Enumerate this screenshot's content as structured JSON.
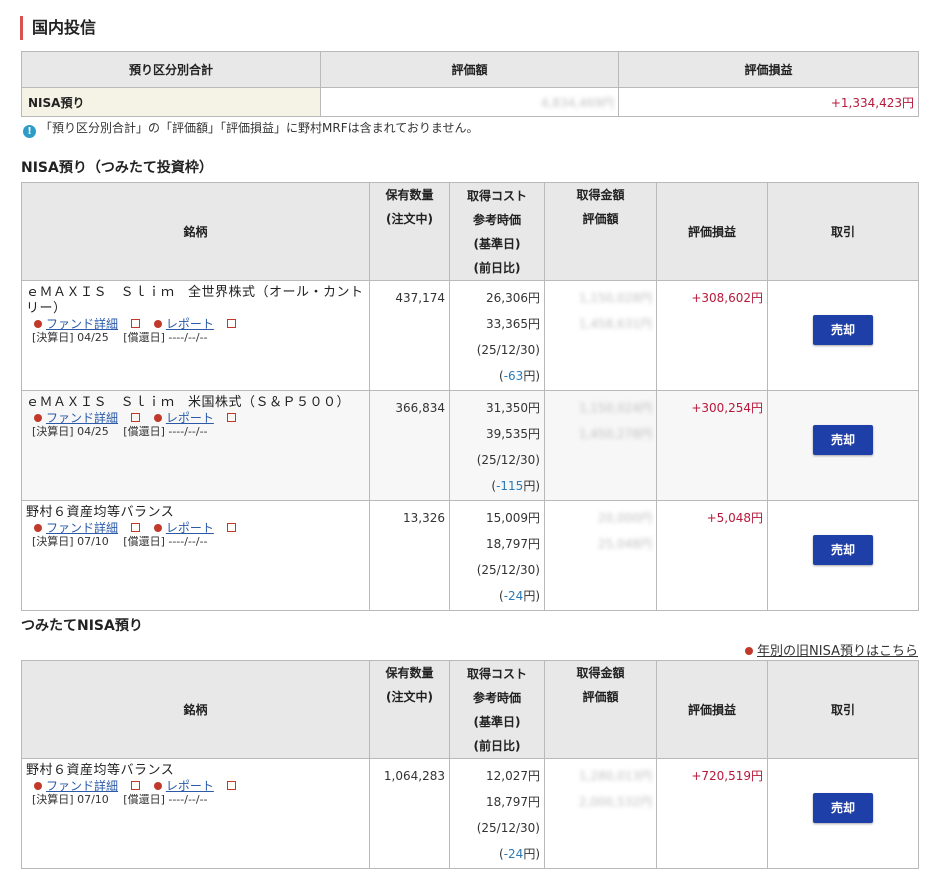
{
  "page": {
    "title": "国内投信"
  },
  "summary": {
    "headers": [
      "預り区分別合計",
      "評価額",
      "評価損益"
    ],
    "row": {
      "label": "NISA預り",
      "value": "4,834,469円",
      "pl": "+1,334,423円"
    }
  },
  "note": "「預り区分別合計」の「評価額」「評価損益」に野村MRFは含まれておりません。",
  "colors": {
    "accent": "#d9534f",
    "positive": "#b7193a",
    "negative": "#2a7ab8",
    "button": "#1f3fa8"
  },
  "icons": {
    "note": "exclamation-circle-icon",
    "bullet": "arrow-bullet-icon",
    "external": "external-window-icon"
  },
  "tables": [
    {
      "title": "NISA預り（つみたて投資枠）",
      "headers": {
        "fund": "銘柄",
        "qty": [
          "保有数量",
          "(注文中)"
        ],
        "cost": [
          "取得コスト",
          "参考時価",
          "(基準日)",
          "(前日比)"
        ],
        "amount": [
          "取得金額",
          "評価額"
        ],
        "pl": "評価損益",
        "trade": "取引"
      },
      "rows": [
        {
          "name": "ｅＭＡＸＩＳ　Ｓｌｉｍ　全世界株式（オール・カントリー）",
          "link1": "ファンド詳細",
          "link2": "レポート",
          "dates": "[決算日] 04/25　 [償還日] ----/--/--",
          "qty": "437,174",
          "cost": "26,306円",
          "price": "33,365円",
          "base_date": "(25/12/30)",
          "change_prefix": "(",
          "change": "-63",
          "change_suffix": "円)",
          "acq_amount": "1,150,028円",
          "eval_amount": "1,458,631円",
          "pl": "+308,602円",
          "sell": "売却"
        },
        {
          "name": "ｅＭＡＸＩＳ　Ｓｌｉｍ　米国株式（Ｓ＆Ｐ５００）",
          "link1": "ファンド詳細",
          "link2": "レポート",
          "dates": "[決算日] 04/25　 [償還日] ----/--/--",
          "qty": "366,834",
          "cost": "31,350円",
          "price": "39,535円",
          "base_date": "(25/12/30)",
          "change_prefix": "(",
          "change": "-115",
          "change_suffix": "円)",
          "acq_amount": "1,150,024円",
          "eval_amount": "1,450,278円",
          "pl": "+300,254円",
          "sell": "売却"
        },
        {
          "name": "野村６資産均等バランス",
          "link1": "ファンド詳細",
          "link2": "レポート",
          "dates": "[決算日] 07/10　 [償還日] ----/--/--",
          "qty": "13,326",
          "cost": "15,009円",
          "price": "18,797円",
          "base_date": "(25/12/30)",
          "change_prefix": "(",
          "change": "-24",
          "change_suffix": "円)",
          "acq_amount": "20,000円",
          "eval_amount": "25,048円",
          "pl": "+5,048円",
          "sell": "売却"
        }
      ]
    },
    {
      "title": "つみたてNISA預り",
      "headers": {
        "fund": "銘柄",
        "qty": [
          "保有数量",
          "(注文中)"
        ],
        "cost": [
          "取得コスト",
          "参考時価",
          "(基準日)",
          "(前日比)"
        ],
        "amount": [
          "取得金額",
          "評価額"
        ],
        "pl": "評価損益",
        "trade": "取引"
      },
      "rows": [
        {
          "name": "野村６資産均等バランス",
          "link1": "ファンド詳細",
          "link2": "レポート",
          "dates": "[決算日] 07/10　 [償還日] ----/--/--",
          "qty": "1,064,283",
          "cost": "12,027円",
          "price": "18,797円",
          "base_date": "(25/12/30)",
          "change_prefix": "(",
          "change": "-24",
          "change_suffix": "円)",
          "acq_amount": "1,280,013円",
          "eval_amount": "2,000,532円",
          "pl": "+720,519円",
          "sell": "売却"
        }
      ]
    }
  ],
  "old_nisa_link": "年別の旧NISA預りはこちら"
}
